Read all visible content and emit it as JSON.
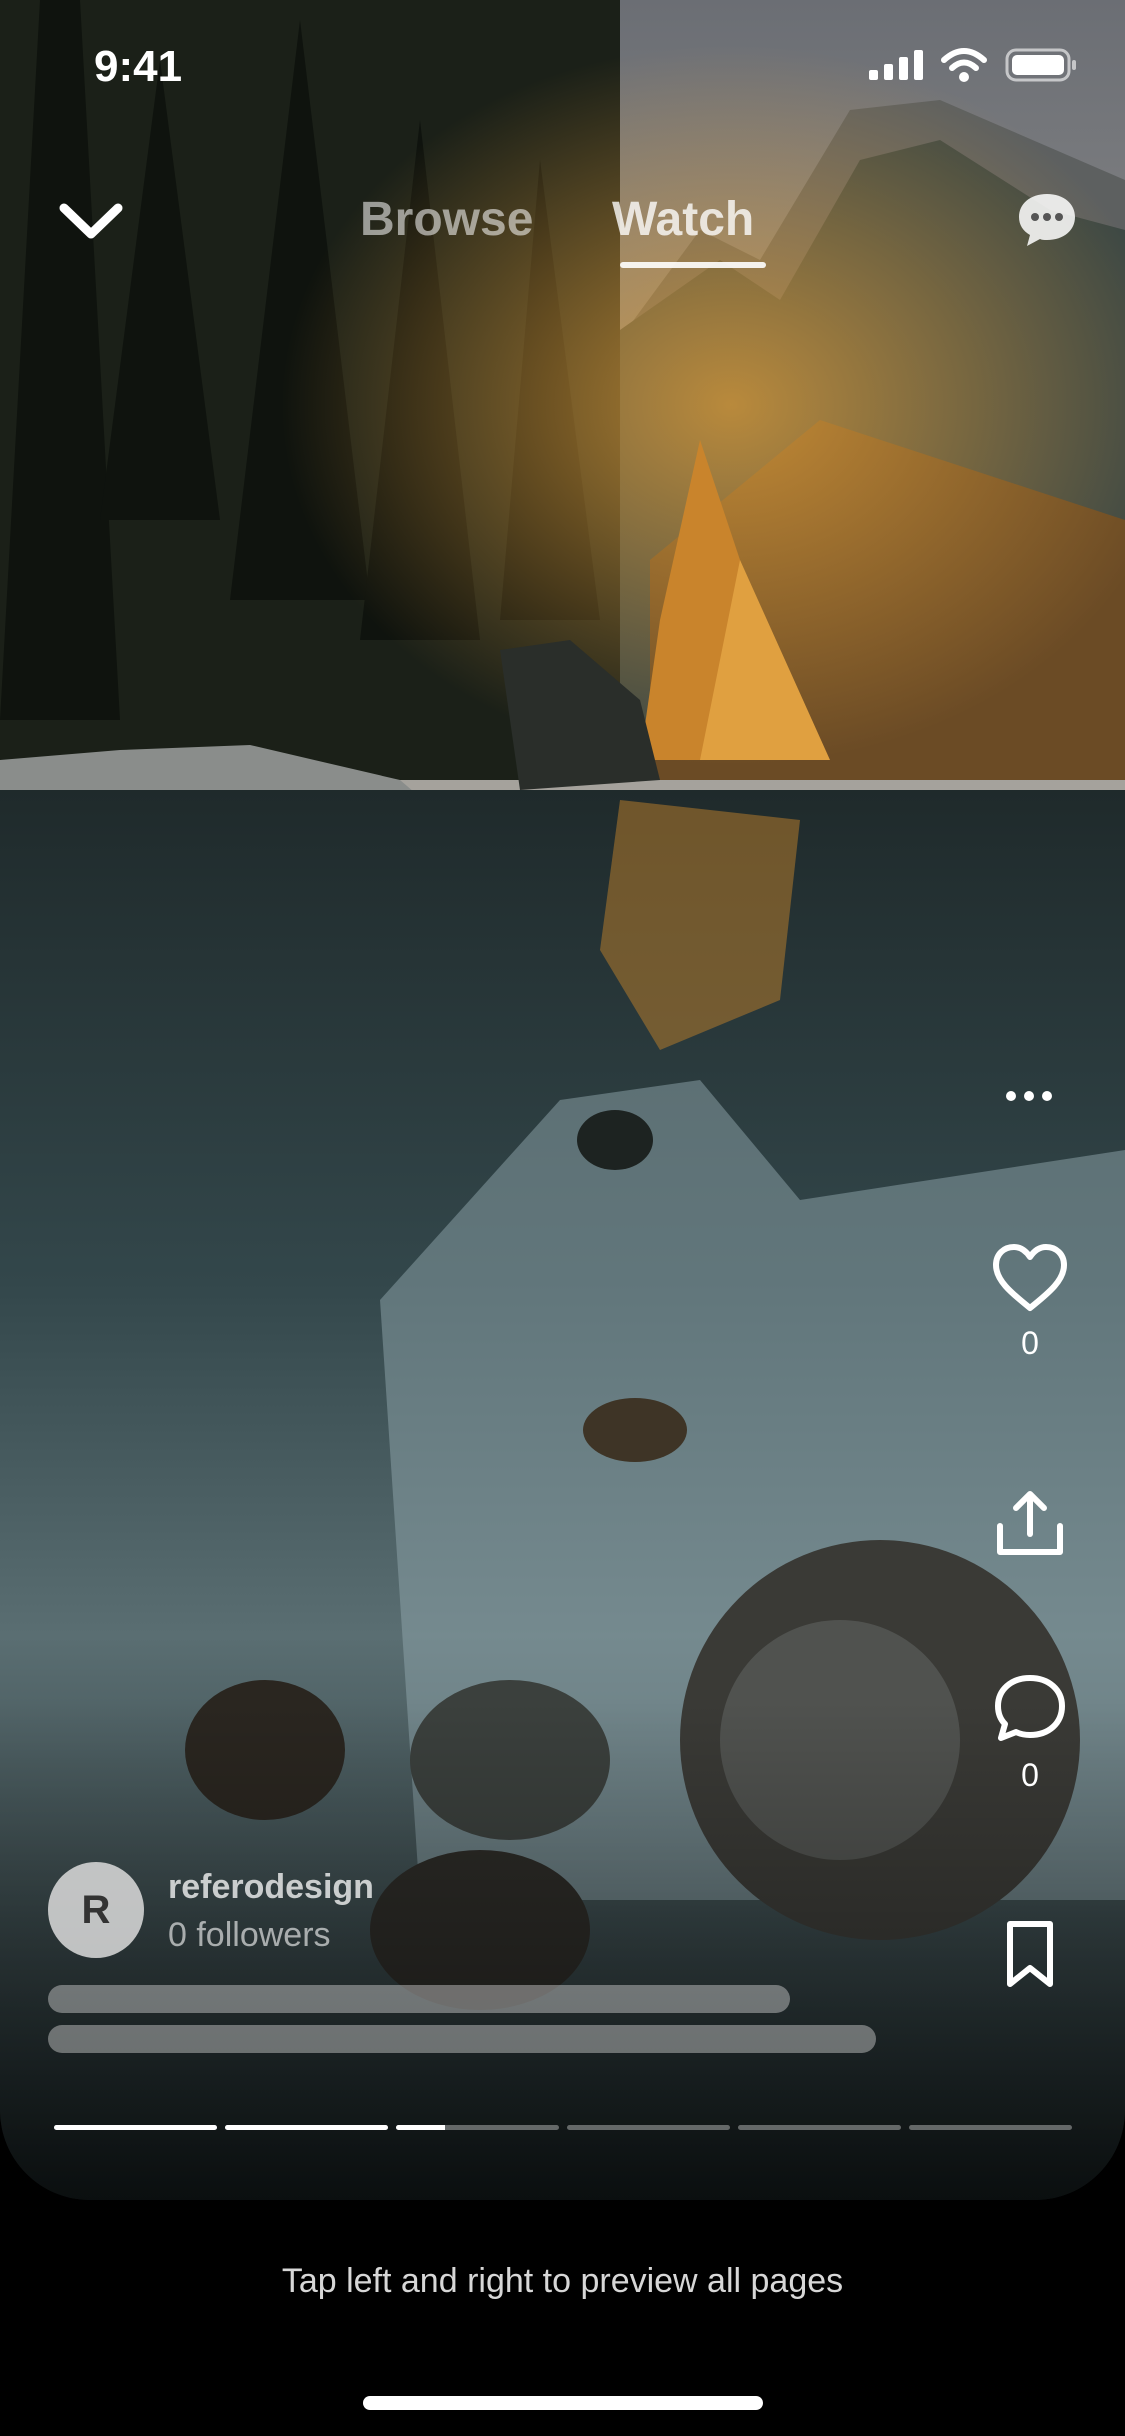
{
  "status_bar": {
    "time": "9:41"
  },
  "nav": {
    "tabs": [
      {
        "label": "Browse"
      },
      {
        "label": "Watch"
      }
    ],
    "active_tab": "Watch"
  },
  "actions": {
    "like_count": "0",
    "comment_count": "0"
  },
  "author": {
    "avatar_initial": "R",
    "name": "referodesign",
    "followers": "0 followers"
  },
  "progress": {
    "segments": 6,
    "current_segment": 3,
    "current_fraction": 0.3
  },
  "hint": "Tap left and right to preview all pages",
  "icons": [
    "chevron-down-icon",
    "message-icon",
    "more-icon",
    "heart-icon",
    "share-icon",
    "comment-icon",
    "bookmark-icon"
  ]
}
